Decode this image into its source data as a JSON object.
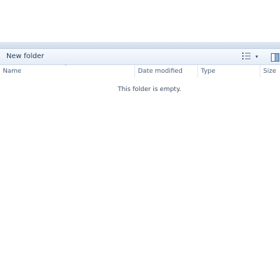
{
  "toolbar": {
    "new_folder_label": "New folder",
    "views_icon": "details-view-icon",
    "dropdown_icon": "▾",
    "preview_pane_icon": "preview-pane-icon"
  },
  "columns": {
    "name": "Name",
    "date_modified": "Date modified",
    "type": "Type",
    "size": "Size",
    "sort_indicator": "ˆ"
  },
  "content": {
    "empty_message": "This folder is empty."
  },
  "colors": {
    "toolbar_text": "#1e395b",
    "header_text": "#4c607a",
    "toolbar_bg": "#eef3fa"
  }
}
